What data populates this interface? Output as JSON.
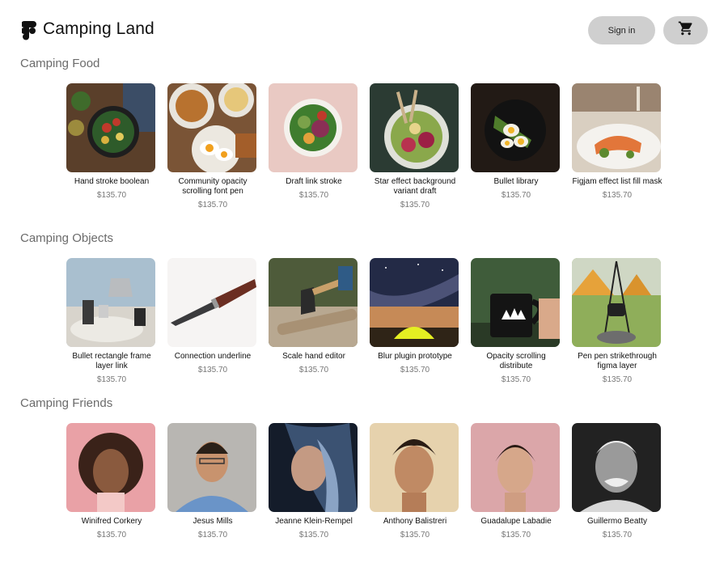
{
  "header": {
    "brand": "Camping Land",
    "logo_icon": "figma-logo-icon",
    "sign_in_label": "Sign in",
    "cart_icon": "shopping-cart-icon"
  },
  "sections": [
    {
      "title": "Camping Food",
      "items": [
        {
          "name": "Hand stroke boolean",
          "price": "$135.70"
        },
        {
          "name": "Community opacity scrolling font pen",
          "price": "$135.70"
        },
        {
          "name": "Draft link stroke",
          "price": "$135.70"
        },
        {
          "name": "Star effect background variant draft",
          "price": "$135.70"
        },
        {
          "name": "Bullet library",
          "price": "$135.70"
        },
        {
          "name": "Figjam effect list fill mask",
          "price": "$135.70"
        }
      ]
    },
    {
      "title": "Camping Objects",
      "items": [
        {
          "name": "Bullet rectangle frame layer link",
          "price": "$135.70"
        },
        {
          "name": "Connection underline",
          "price": "$135.70"
        },
        {
          "name": "Scale hand editor",
          "price": "$135.70"
        },
        {
          "name": "Blur plugin prototype",
          "price": "$135.70"
        },
        {
          "name": "Opacity scrolling distribute",
          "price": "$135.70"
        },
        {
          "name": "Pen pen strikethrough figma layer",
          "price": "$135.70"
        }
      ]
    },
    {
      "title": "Camping Friends",
      "items": [
        {
          "name": "Winifred Corkery",
          "price": "$135.70"
        },
        {
          "name": "Jesus Mills",
          "price": "$135.70"
        },
        {
          "name": "Jeanne Klein-Rempel",
          "price": "$135.70"
        },
        {
          "name": "Anthony Balistreri",
          "price": "$135.70"
        },
        {
          "name": "Guadalupe Labadie",
          "price": "$135.70"
        },
        {
          "name": "Guillermo Beatty",
          "price": "$135.70"
        }
      ]
    }
  ]
}
